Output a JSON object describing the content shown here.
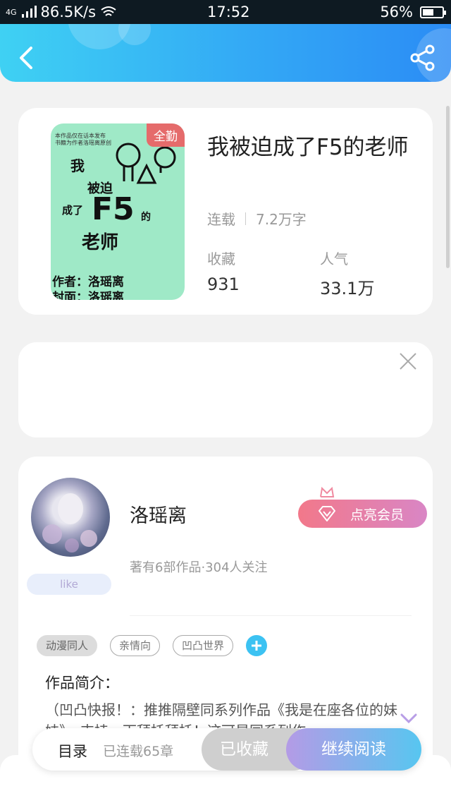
{
  "status_bar": {
    "network": "4G",
    "speed": "86.5K/s",
    "time": "17:52",
    "battery": "56%",
    "battery_fraction": 0.56
  },
  "header": {
    "back_icon": "chevron-left-icon",
    "share_icon": "share-icon"
  },
  "book": {
    "cover_badge": "全勤",
    "cover_lines": [
      "我",
      "被迫",
      "成了",
      "F5",
      "的",
      "老师",
      "作者：洛瑶离",
      "封面：洛瑶离"
    ],
    "title": "我被迫成了F5的老师",
    "status": "连载",
    "word_count": "7.2万字",
    "stats": [
      {
        "label": "收藏",
        "value": "931"
      },
      {
        "label": "人气",
        "value": "33.1万"
      }
    ]
  },
  "ad": {
    "close_icon": "close-icon"
  },
  "author": {
    "name": "洛瑶离",
    "vip_label": "点亮会员",
    "info": "著有6部作品·304人关注",
    "badge": "like",
    "tags": [
      "动漫同人",
      "亲情向",
      "凹凸世界"
    ],
    "intro_label": "作品简介：",
    "intro_text": "（凹凸快报！：推推隔壁同系列作品《我是在座各位的妹妹》，支持一下拜托拜托！这可是同系列作"
  },
  "bottom_bar": {
    "toc_label": "目录",
    "toc_count": "已连载65章",
    "collected_label": "已收藏",
    "read_label": "继续阅读"
  },
  "colors": {
    "header_start": "#3fd1f3",
    "header_end": "#2b8cf5",
    "accent_blue": "#3cc2f2",
    "vip_pink": "#f2788a",
    "read_gradient_start": "#b49be6",
    "read_gradient_end": "#57c6f0"
  }
}
